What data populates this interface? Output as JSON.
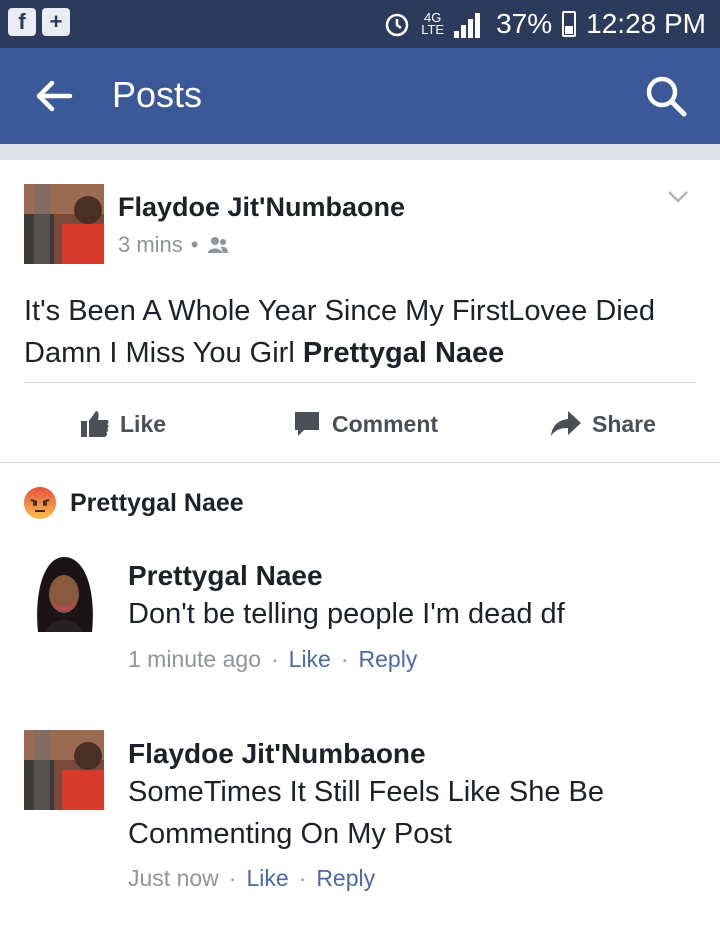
{
  "status_bar": {
    "network_label": "4G",
    "network_sub": "LTE",
    "battery": "37%",
    "time": "12:28 PM"
  },
  "app_bar": {
    "title": "Posts"
  },
  "post": {
    "author": "Flaydoe Jit'Numbaone",
    "time": "3 mins",
    "text": "It's Been A Whole Year Since My FirstLovee Died Damn I Miss You Girl ",
    "tagged": "Prettygal Naee"
  },
  "actions": {
    "like": "Like",
    "comment": "Comment",
    "share": "Share"
  },
  "reaction": {
    "name": "Prettygal Naee"
  },
  "comments": [
    {
      "author": "Prettygal Naee",
      "text": "Don't be telling people I'm dead df",
      "time": "1 minute ago",
      "like": "Like",
      "reply": "Reply"
    },
    {
      "author": "Flaydoe Jit'Numbaone",
      "text": "SomeTimes It Still Feels Like She Be Commenting On My Post",
      "time": "Just now",
      "like": "Like",
      "reply": "Reply"
    }
  ],
  "colors": {
    "fb_blue": "#3b5998",
    "status_bar": "#2c3a5c",
    "meta_gray": "#90949c",
    "link": "#4b6aa8"
  }
}
